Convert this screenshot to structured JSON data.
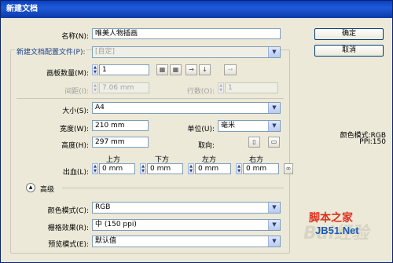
{
  "dialog": {
    "title": "新建文档"
  },
  "fields": {
    "name_label": "名称(N):",
    "name_value": "唯美人物插画",
    "profile_label": "新建文档配置文件(P):",
    "profile_value": "[自定]",
    "artboards_label": "画板数量(M):",
    "artboards_value": "1",
    "spacing_label": "间距(I):",
    "spacing_value": "7.06 mm",
    "columns_label": "行数(O):",
    "columns_value": "1",
    "size_label": "大小(S):",
    "size_value": "A4",
    "width_label": "宽度(W):",
    "width_value": "210 mm",
    "units_label": "单位(U):",
    "units_value": "毫米",
    "height_label": "高度(H):",
    "height_value": "297 mm",
    "orientation_label": "取向:",
    "bleed_label": "出血(L):",
    "bleed_top_label": "上方",
    "bleed_top_value": "0 mm",
    "bleed_bottom_label": "下方",
    "bleed_bottom_value": "0 mm",
    "bleed_left_label": "左方",
    "bleed_left_value": "0 mm",
    "bleed_right_label": "右方",
    "bleed_right_value": "0 mm"
  },
  "advanced": {
    "header": "高级",
    "color_mode_label": "颜色模式(C):",
    "color_mode_value": "RGB",
    "raster_label": "栅格效果(R):",
    "raster_value": "中 (150 ppi)",
    "preview_label": "预览模式(E):",
    "preview_value": "默认值"
  },
  "buttons": {
    "ok": "确定",
    "cancel": "取消"
  },
  "info": {
    "line1": "颜色模式:RGB",
    "line2": "PPI:150"
  },
  "watermark": {
    "brand": "脚本之家",
    "site": "JB51.Net",
    "faint": "Bai经验"
  },
  "colors": {
    "title_bar": "#0a3fc0",
    "brand_red": "#e0301e",
    "brand_blue": "#1a5ab4"
  }
}
